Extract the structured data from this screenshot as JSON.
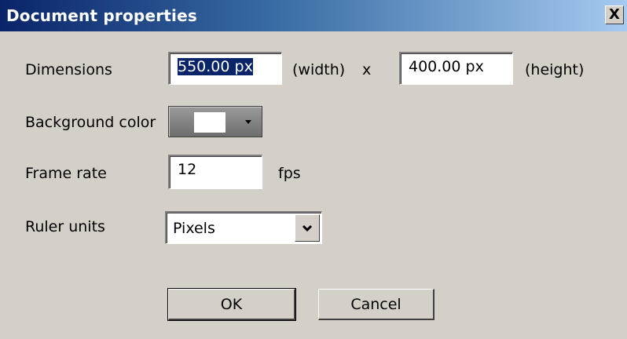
{
  "window": {
    "title": "Document properties",
    "close_glyph": "X"
  },
  "dimensions": {
    "label": "Dimensions",
    "width_value": "550.00 px",
    "width_suffix": "(width)",
    "separator": "x",
    "height_value": "400.00 px",
    "height_suffix": "(height)"
  },
  "background": {
    "label": "Background color",
    "color": "#ffffff"
  },
  "frame_rate": {
    "label": "Frame rate",
    "value": "12",
    "unit": "fps"
  },
  "ruler": {
    "label": "Ruler units",
    "selected": "Pixels"
  },
  "buttons": {
    "ok": "OK",
    "cancel": "Cancel"
  },
  "colors": {
    "title_start": "#0a246a",
    "title_end": "#a6caf0",
    "face": "#d4d0c8",
    "selection": "#0a246a"
  }
}
